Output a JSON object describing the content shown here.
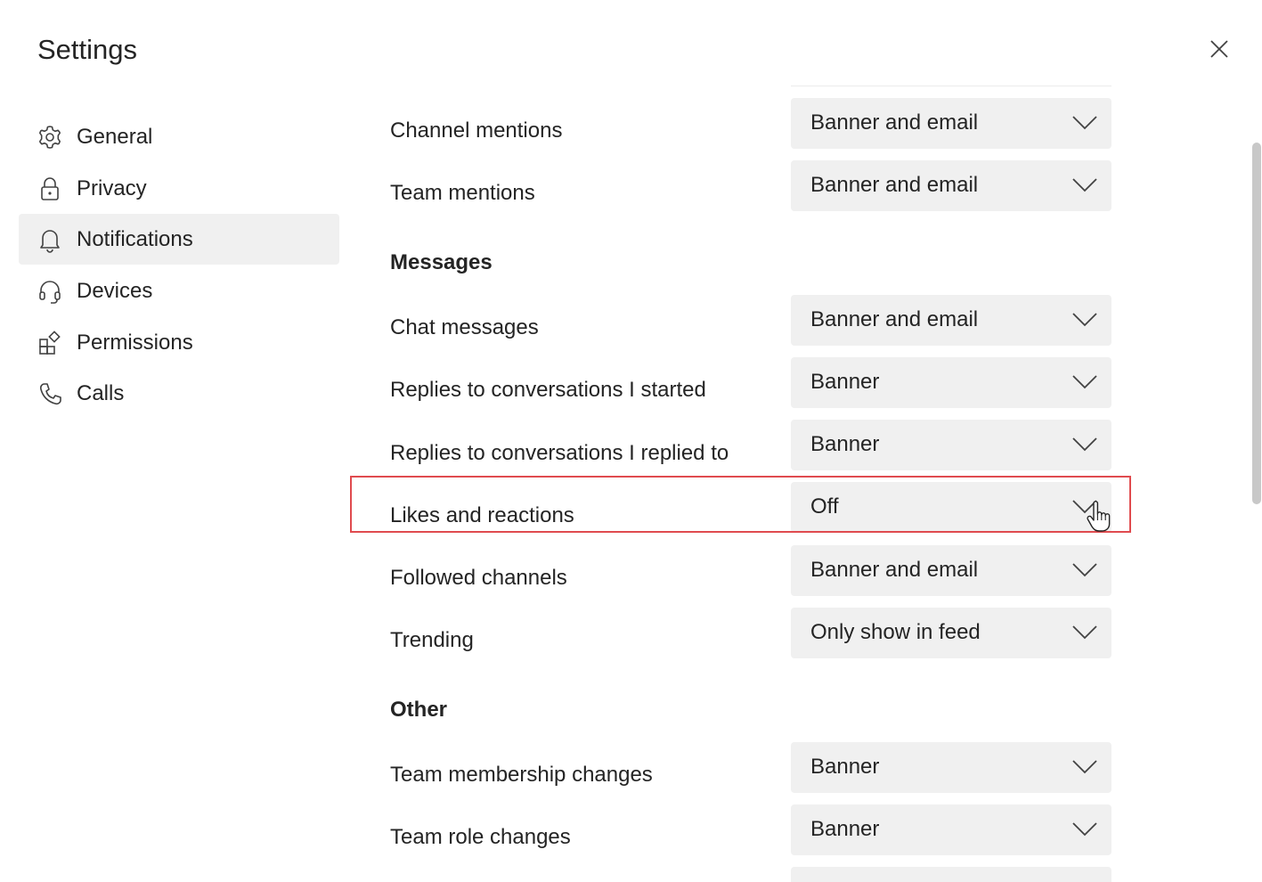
{
  "header": {
    "title": "Settings",
    "close_icon": "close-icon"
  },
  "sidebar": {
    "items": [
      {
        "label": "General",
        "icon": "gear-icon",
        "active": false
      },
      {
        "label": "Privacy",
        "icon": "lock-icon",
        "active": false
      },
      {
        "label": "Notifications",
        "icon": "bell-icon",
        "active": true
      },
      {
        "label": "Devices",
        "icon": "headset-icon",
        "active": false
      },
      {
        "label": "Permissions",
        "icon": "apps-icon",
        "active": false
      },
      {
        "label": "Calls",
        "icon": "phone-icon",
        "active": false
      }
    ]
  },
  "main": {
    "rows_top": [
      {
        "label": "Channel mentions",
        "value": "Banner and email"
      },
      {
        "label": "Team mentions",
        "value": "Banner and email"
      }
    ],
    "sections": [
      {
        "title": "Messages",
        "rows": [
          {
            "label": "Chat messages",
            "value": "Banner and email"
          },
          {
            "label": "Replies to conversations I started",
            "value": "Banner"
          },
          {
            "label": "Replies to conversations I replied to",
            "value": "Banner"
          },
          {
            "label": "Likes and reactions",
            "value": "Off"
          },
          {
            "label": "Followed channels",
            "value": "Banner and email"
          },
          {
            "label": "Trending",
            "value": "Only show in feed"
          }
        ]
      },
      {
        "title": "Other",
        "rows": [
          {
            "label": "Team membership changes",
            "value": "Banner"
          },
          {
            "label": "Team role changes",
            "value": "Banner"
          }
        ]
      }
    ]
  },
  "colors": {
    "dropdown_bg": "#f0f0f0",
    "active_nav_bg": "#f0f0f0",
    "highlight_border": "#e04b4f",
    "text": "#242424"
  }
}
